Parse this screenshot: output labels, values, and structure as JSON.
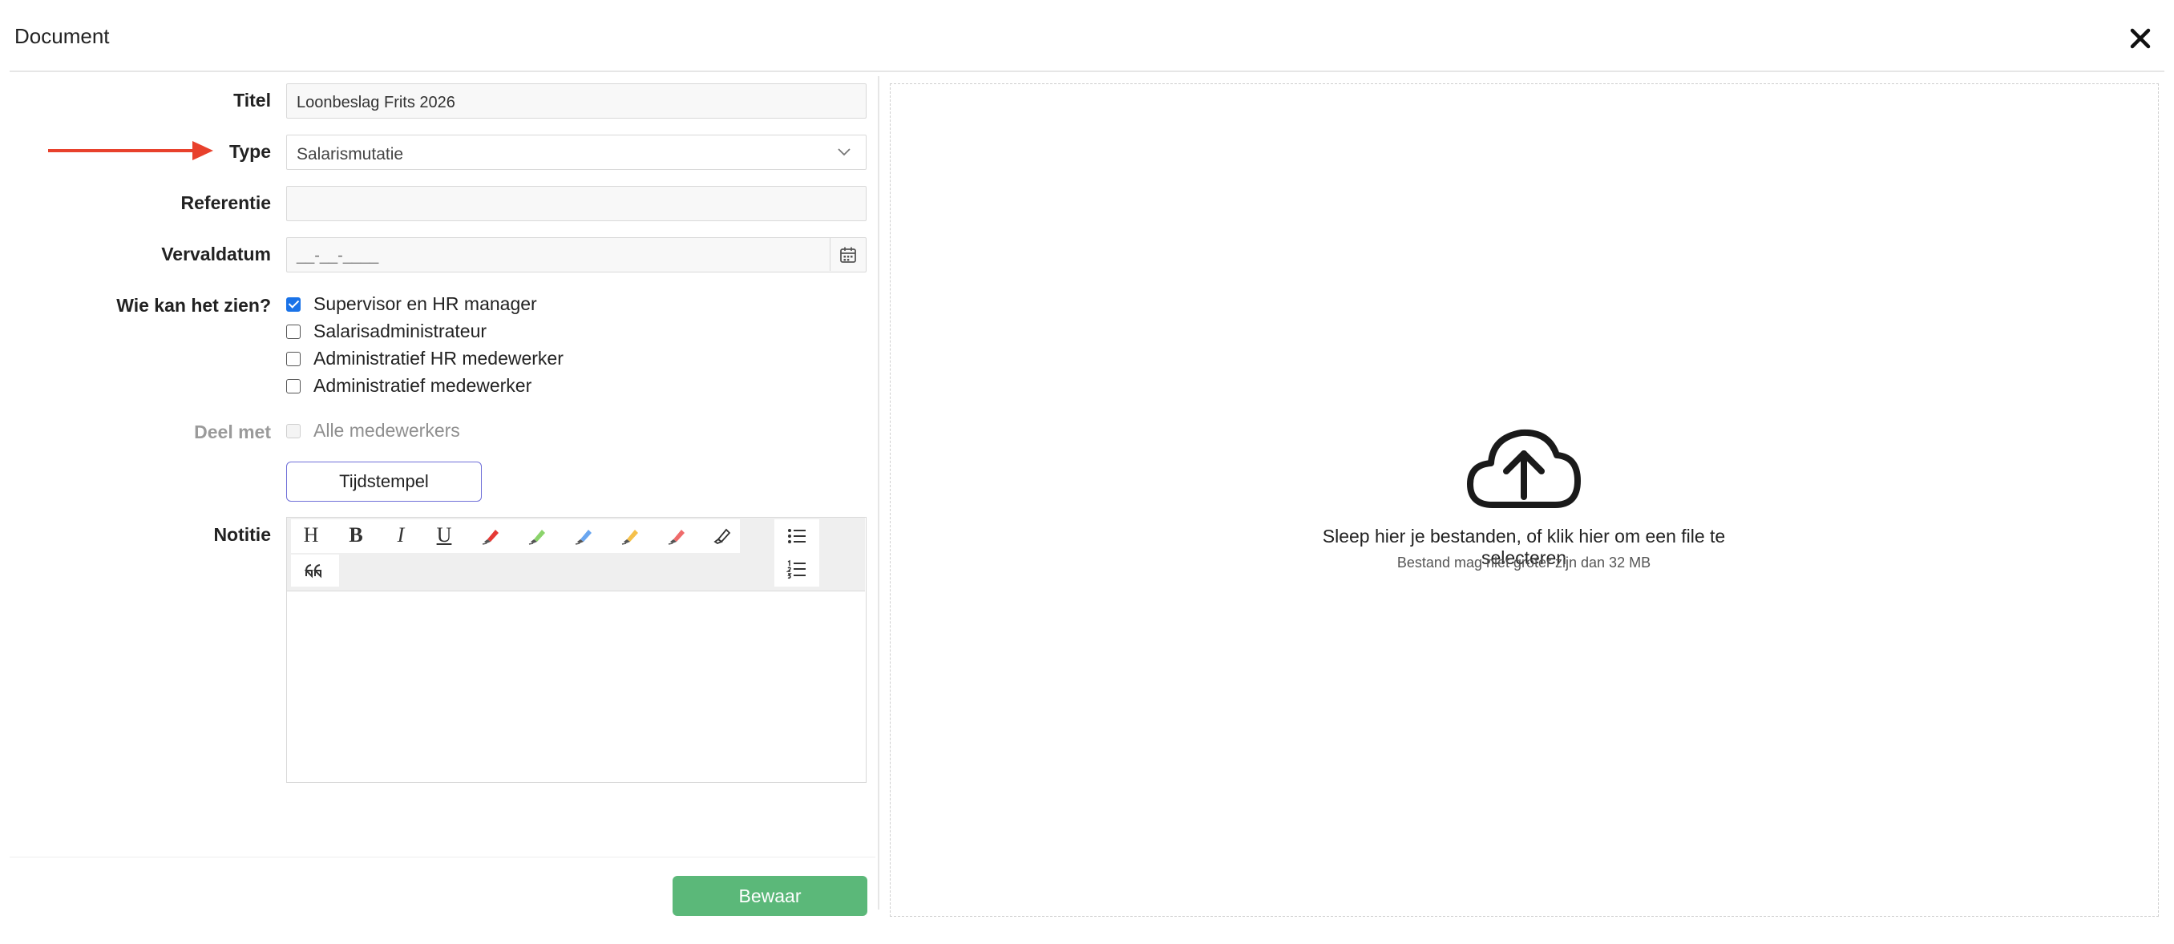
{
  "header": {
    "title": "Document"
  },
  "form": {
    "title_label": "Titel",
    "title_value": "Loonbeslag Frits 2026",
    "type_label": "Type",
    "type_value": "Salarismutatie",
    "reference_label": "Referentie",
    "reference_value": "",
    "expiry_label": "Vervaldatum",
    "expiry_value": "__-__-____",
    "visibility_label": "Wie kan het zien?",
    "visibility_options": [
      {
        "label": "Supervisor en HR manager",
        "checked": true
      },
      {
        "label": "Salarisadministrateur",
        "checked": false
      },
      {
        "label": "Administratief HR medewerker",
        "checked": false
      },
      {
        "label": "Administratief medewerker",
        "checked": false
      }
    ],
    "share_label": "Deel met",
    "share_option": "Alle medewerkers",
    "timestamp_button": "Tijdstempel",
    "note_label": "Notitie",
    "note_value": ""
  },
  "toolbar": {
    "heading": "H",
    "bold": "B",
    "italic": "I",
    "underline": "U",
    "marker_colors": [
      "#e53935",
      "#8bd36b",
      "#6aa6f0",
      "#f5c04a",
      "#ef6b6b"
    ]
  },
  "upload": {
    "text": "Sleep hier je bestanden, of klik hier om een file te selecteren",
    "subtext": "Bestand mag niet groter zijn dan 32 MB"
  },
  "footer": {
    "save_label": "Bewaar"
  },
  "colors": {
    "save": "#5bb879",
    "check": "#1a73e8",
    "arrow": "#e8412c",
    "stamp_border": "#6f6fd8"
  }
}
